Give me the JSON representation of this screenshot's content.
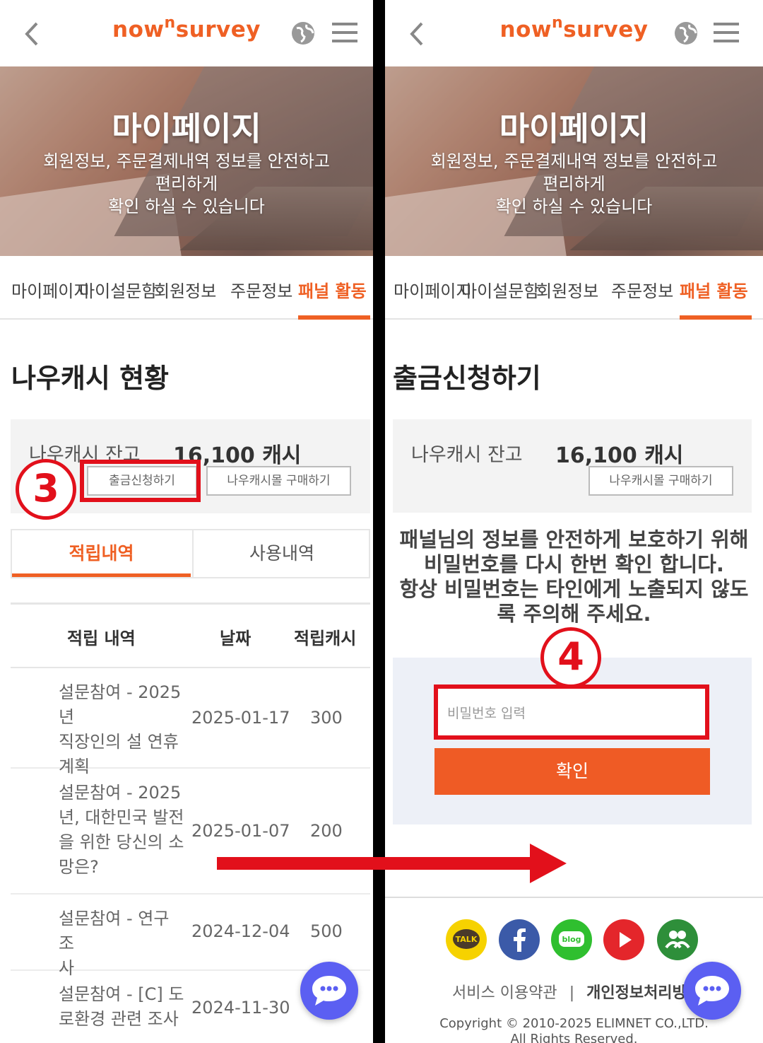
{
  "colors": {
    "accent": "#ef6024",
    "annotation_red": "#e2101b",
    "chat": "#5b5ff2"
  },
  "header": {
    "logo_left": "now",
    "logo_sup": "n",
    "logo_right": "survey",
    "icons": [
      "back-chevron-icon",
      "globe-icon",
      "hamburger-menu-icon"
    ]
  },
  "hero": {
    "title": "마이페이지",
    "subtitle_line1": "회원정보, 주문결제내역 정보를 안전하고",
    "subtitle_line2": "편리하게",
    "subtitle_line3": "확인 하실 수 있습니다"
  },
  "nav": {
    "items": [
      "마이페이지",
      "마이설문함",
      "회원정보",
      "주문정보",
      "패널 활동"
    ],
    "active": "패널 활동"
  },
  "left": {
    "title": "나우캐시 현황",
    "balance_label": "나우캐시 잔고",
    "balance_value": "16,100 캐시",
    "withdraw_button": "출금신청하기",
    "mall_button": "나우캐시몰 구매하기",
    "annotation": "3",
    "tabs": [
      "적립내역",
      "사용내역"
    ],
    "table": {
      "headers": [
        "적립 내역",
        "날짜",
        "적립캐시"
      ],
      "rows": [
        {
          "desc": [
            "설문참여 - 2025년",
            "직장인의 설 연휴",
            "계획"
          ],
          "date": "2025-01-17",
          "amount": "300"
        },
        {
          "desc": [
            "설문참여 - 2025",
            "년, 대한민국 발전",
            "을 위한 당신의 소",
            "망은?"
          ],
          "date": "2025-01-07",
          "amount": "200"
        },
        {
          "desc": [
            "설문참여 - 연구 조",
            "사"
          ],
          "date": "2024-12-04",
          "amount": "500"
        },
        {
          "desc": [
            "설문참여 - [C] 도",
            "로환경 관련 조사"
          ],
          "date": "2024-11-30",
          "amount": ""
        }
      ]
    }
  },
  "right": {
    "title": "출금신청하기",
    "balance_label": "나우캐시 잔고",
    "balance_value": "16,100 캐시",
    "mall_button": "나우캐시몰 구매하기",
    "notice": [
      "패널님의 정보를 안전하게 보호하기 위해",
      "비밀번호를 다시 한번 확인 합니다.",
      "항상 비밀번호는 타인에게 노출되지 않도",
      "록 주의해 주세요."
    ],
    "annotation": "4",
    "password_placeholder": "비밀번호 입력",
    "confirm_button": "확인",
    "social_icons": [
      "kakaotalk-icon",
      "facebook-icon",
      "blog-icon",
      "youtube-icon",
      "community-icon"
    ],
    "kakao_label": "TALK",
    "blog_label": "blog",
    "footer_terms": "서비스 이용약관",
    "footer_sep": "|",
    "footer_privacy": "개인정보처리방침",
    "copyright_line1": "Copyright © 2010-2025 ELIMNET CO.,LTD.",
    "copyright_line2": "All Rights Reserved."
  }
}
